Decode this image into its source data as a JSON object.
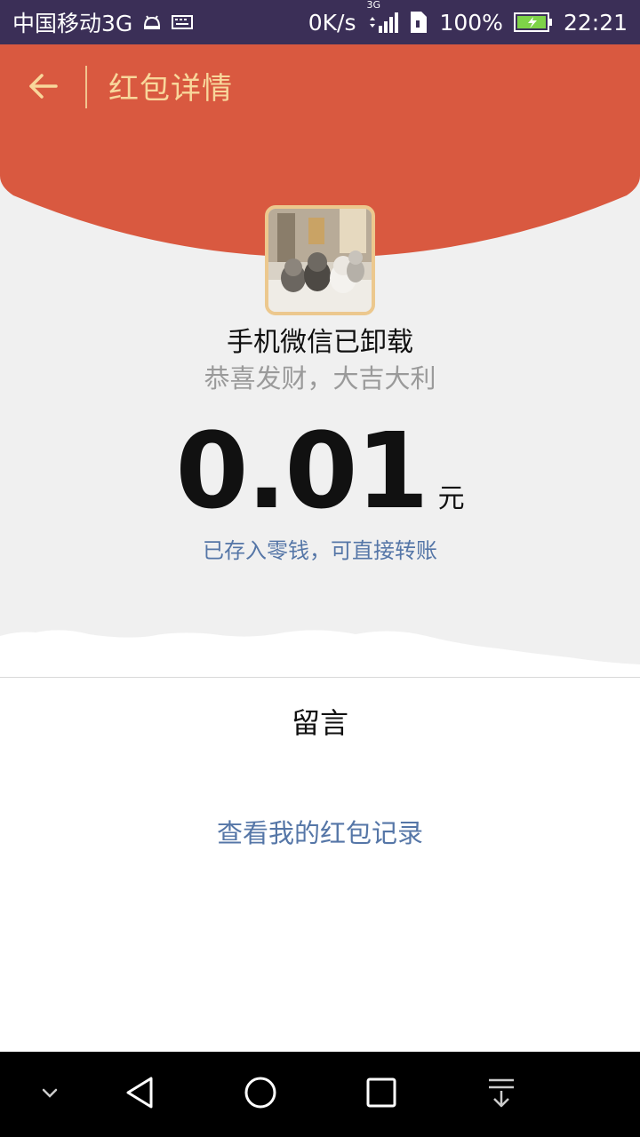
{
  "status_bar": {
    "carrier": "中国移动3G",
    "net_speed": "0K/s",
    "network_type": "3G",
    "battery": "100%",
    "time": "22:21",
    "icons": [
      "android-debug-icon",
      "keyboard-icon",
      "signal-icon",
      "sim-icon",
      "battery-charging-icon"
    ]
  },
  "header": {
    "title": "红包详情",
    "back_icon": "arrow-left-icon"
  },
  "envelope": {
    "sender_name": "手机微信已卸载",
    "greeting": "恭喜发财，大吉大利",
    "amount": "0.01",
    "unit": "元",
    "saved_note": "已存入零钱，可直接转账"
  },
  "message": {
    "label": "留言"
  },
  "history": {
    "link": "查看我的红包记录"
  },
  "nav_bar": {
    "icons": [
      "chevron-down-icon",
      "back-triangle-icon",
      "home-circle-icon",
      "recents-square-icon",
      "notification-pull-icon"
    ]
  },
  "colors": {
    "header_red": "#d95940",
    "title_gold": "#f8d79b",
    "link_blue": "#5576a7",
    "status_bar": "#3b2f57",
    "body_gray": "#f0f0f0"
  }
}
